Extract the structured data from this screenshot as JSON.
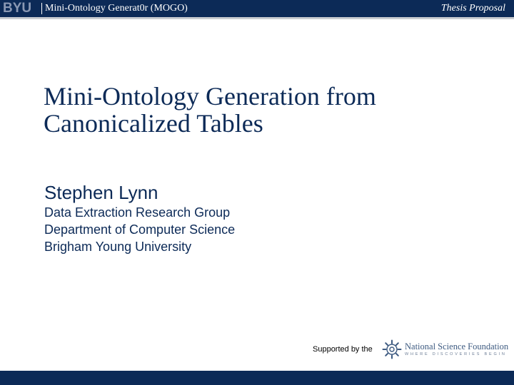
{
  "header": {
    "logo": "BYU",
    "title": "Mini-Ontology Generat0r (MOGO)",
    "right_label": "Thesis Proposal"
  },
  "slide": {
    "title_lines": [
      "Mini-Ontology Generation from",
      "Canonicalized Tables"
    ],
    "author": "Stephen Lynn",
    "affiliation_lines": [
      "Data Extraction Research Group",
      "Department of Computer Science",
      "Brigham Young University"
    ]
  },
  "sponsor": {
    "supported_by": "Supported by the",
    "name": "National Science Foundation",
    "tagline": "WHERE DISCOVERIES BEGIN"
  },
  "colors": {
    "navy": "#0c2a57",
    "rule": "#c9ccd1",
    "nsf_blue": "#3d5a80"
  }
}
